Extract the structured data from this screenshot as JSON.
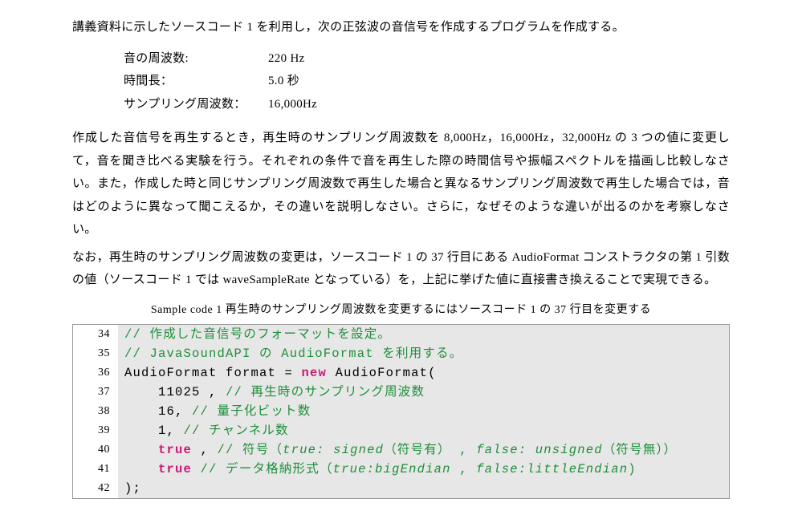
{
  "intro": "講義資料に示したソースコード 1 を利用し，次の正弦波の音信号を作成するプログラムを作成する。",
  "params": {
    "freq_label": "音の周波数:",
    "freq_value": "220 Hz",
    "dur_label": "時間長：",
    "dur_value": "5.0 秒",
    "samp_label": "サンプリング周波数：",
    "samp_value": "16,000Hz"
  },
  "body1": "作成した音信号を再生するとき，再生時のサンプリング周波数を 8,000Hz，16,000Hz，32,000Hz の 3 つの値に変更して，音を聞き比べる実験を行う。それぞれの条件で音を再生した際の時間信号や振幅スペクトルを描画し比較しなさい。また，作成した時と同じサンプリング周波数で再生した場合と異なるサンプリング周波数で再生した場合では，音はどのように異なって聞こえるか，その違いを説明しなさい。さらに，なぜそのような違いが出るのかを考察しなさい。",
  "body2": "なお，再生時のサンプリング周波数の変更は，ソースコード 1 の 37 行目にある AudioFormat コンストラクタの第 1 引数の値（ソースコード 1 では waveSampleRate となっている）を，上記に挙げた値に直接書き換えることで実現できる。",
  "caption": "Sample code 1   再生時のサンプリング周波数を変更するにはソースコード 1 の 37 行目を変更する",
  "code": {
    "ln34_no": "34",
    "ln34_comment": "// 作成した音信号のフォーマットを設定。",
    "ln35_no": "35",
    "ln35_comment": "// JavaSoundAPI の AudioFormat を利用する。",
    "ln36_no": "36",
    "ln36_a": "AudioFormat format = ",
    "ln36_kw": "new",
    "ln36_b": " AudioFormat(",
    "ln37_no": "37",
    "ln37_val": "    11025 , ",
    "ln37_comment": "// 再生時のサンプリング周波数",
    "ln38_no": "38",
    "ln38_val": "    16, ",
    "ln38_comment": "// 量子化ビット数",
    "ln39_no": "39",
    "ln39_val": "    1, ",
    "ln39_comment": "// チャンネル数",
    "ln40_no": "40",
    "ln40_indent": "    ",
    "ln40_kw": "true",
    "ln40_sep": " , ",
    "ln40_comment_a": "// 符号（",
    "ln40_comment_i1": "true: signed",
    "ln40_comment_b": "（符号有） , ",
    "ln40_comment_i2": "false: unsigned",
    "ln40_comment_c": "（符号無））",
    "ln41_no": "41",
    "ln41_indent": "    ",
    "ln41_kw": "true",
    "ln41_sep": " ",
    "ln41_comment_a": "// データ格納形式（",
    "ln41_comment_i1": "true:bigEndian",
    "ln41_comment_b": " , ",
    "ln41_comment_i2": "false:littleEndian",
    "ln41_comment_c": ")",
    "ln42_no": "42",
    "ln42_val": ");"
  }
}
